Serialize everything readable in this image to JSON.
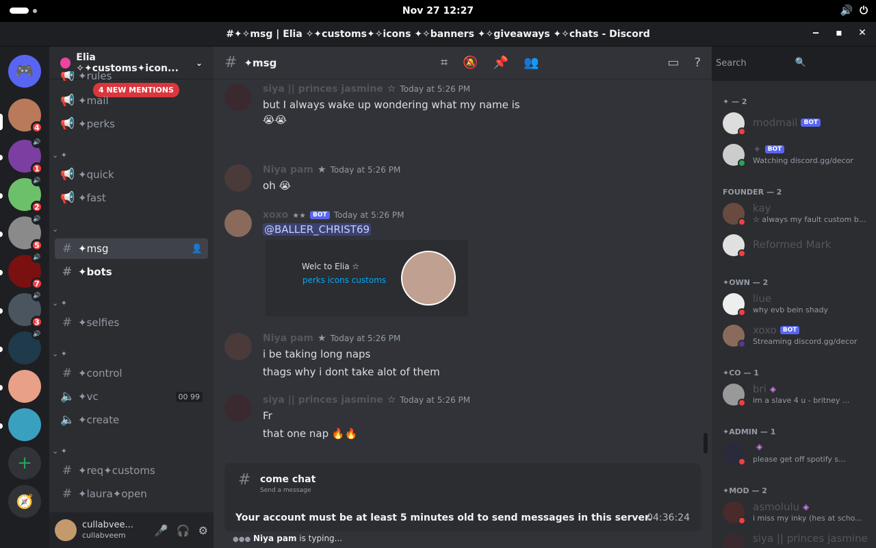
{
  "system": {
    "clock": "Nov 27  12:27",
    "volume_icon": "volume-icon",
    "power_icon": "power-icon"
  },
  "window": {
    "title": "#✦✧msg | Elia ✧✦customs✦✧icons ✦✧banners ✦✧giveaways ✦✧chats - Discord",
    "minimize": "‒",
    "maximize": "▪",
    "close": "✕"
  },
  "rail": {
    "servers": [
      {
        "color": "#b87a5a",
        "badge": "4"
      },
      {
        "color": "#7a3fa0",
        "badge": "1"
      },
      {
        "color": "#6cc06a",
        "badge": "2"
      },
      {
        "color": "#8a8a8a",
        "badge": "5"
      },
      {
        "color": "#7a1010",
        "badge": "7"
      },
      {
        "color": "#4a5560",
        "badge": "3"
      },
      {
        "color": "#1f3a4a",
        "badge": ""
      },
      {
        "color": "#e8a088",
        "badge": ""
      },
      {
        "color": "#3aa0c0",
        "badge": ""
      }
    ]
  },
  "sidebar": {
    "guild_name": "Elia ✧✦customs✦icon...",
    "mentions": "4 NEW MENTIONS",
    "channels": {
      "rules": "✦rules",
      "mail": "✦mail",
      "perks": "✦perks",
      "quick": "✦quick",
      "fast": "✦fast",
      "msg": "✦msg",
      "bots": "✦bots",
      "selfies": "✦selfies",
      "control": "✦control",
      "vc": "✦vc",
      "vc_count_a": "00",
      "vc_count_b": "99",
      "create": "✦create",
      "req_customs": "✦req✦customs",
      "laura_open": "✦laura✦open"
    },
    "category": "✦"
  },
  "user": {
    "name": "cullabvee...",
    "handle": "cullabveem"
  },
  "header": {
    "channel": "✦msg",
    "search_placeholder": "Search"
  },
  "messages": [
    {
      "author": "siya || princes jasmine",
      "time": "Today at 5:26 PM",
      "text": "but I always wake up wondering what my name is",
      "emoji": "😭😭"
    },
    {
      "author": "Niya pam",
      "time": "Today at 5:26 PM",
      "text": "oh 😭"
    },
    {
      "author": "xoxo",
      "badge": "BOT",
      "time": "Today at 5:26 PM",
      "mention": "@BALLER_CHRIST69",
      "embed_title": "Welc to Elia ☆",
      "embed_links": "perks icons customs"
    },
    {
      "author": "Niya pam",
      "time": "Today at 5:26 PM",
      "text": "i be taking long naps",
      "text2": "thags why i dont take alot of them"
    },
    {
      "author": "siya || princes jasmine",
      "time": "Today at 5:26 PM",
      "text": "Fr",
      "text2": "that one nap 🔥🔥"
    }
  ],
  "notice": {
    "channel": "come chat",
    "sub": "Send a message",
    "text": "Your account must be at least 5 minutes old to send messages in this server.",
    "timer": "04:36:24"
  },
  "typing": {
    "user": "Niya pam",
    "text": " is typing..."
  },
  "members": {
    "groups": [
      {
        "label": "✦ — 2"
      },
      {
        "label": "FOUNDER — 2"
      },
      {
        "label": "✦OWN — 2"
      },
      {
        "label": "✦CO — 1"
      },
      {
        "label": "✦ADMIN — 1"
      },
      {
        "label": "✦MOD — 2"
      }
    ],
    "list": [
      {
        "name": "modmail",
        "badge": "BOT",
        "sub": ""
      },
      {
        "name": "✦",
        "badge": "BOT",
        "sub": "Watching discord.gg/decor"
      },
      {
        "name": "kay",
        "sub": "☆ always my fault custom ba..."
      },
      {
        "name": "Reformed Mark",
        "sub": ""
      },
      {
        "name": "liue",
        "sub": "why evb bein shady"
      },
      {
        "name": "xoxo",
        "badge": "BOT",
        "sub": "Streaming discord.gg/decor"
      },
      {
        "name": "bri",
        "sub": "im a slave 4 u - britney ..."
      },
      {
        "name": "",
        "sub": "please get off spotify s..."
      },
      {
        "name": "asmolulu",
        "sub": "i miss my inky (hes at scho..."
      },
      {
        "name": "siya || princes jasmine",
        "sub": ""
      }
    ]
  }
}
